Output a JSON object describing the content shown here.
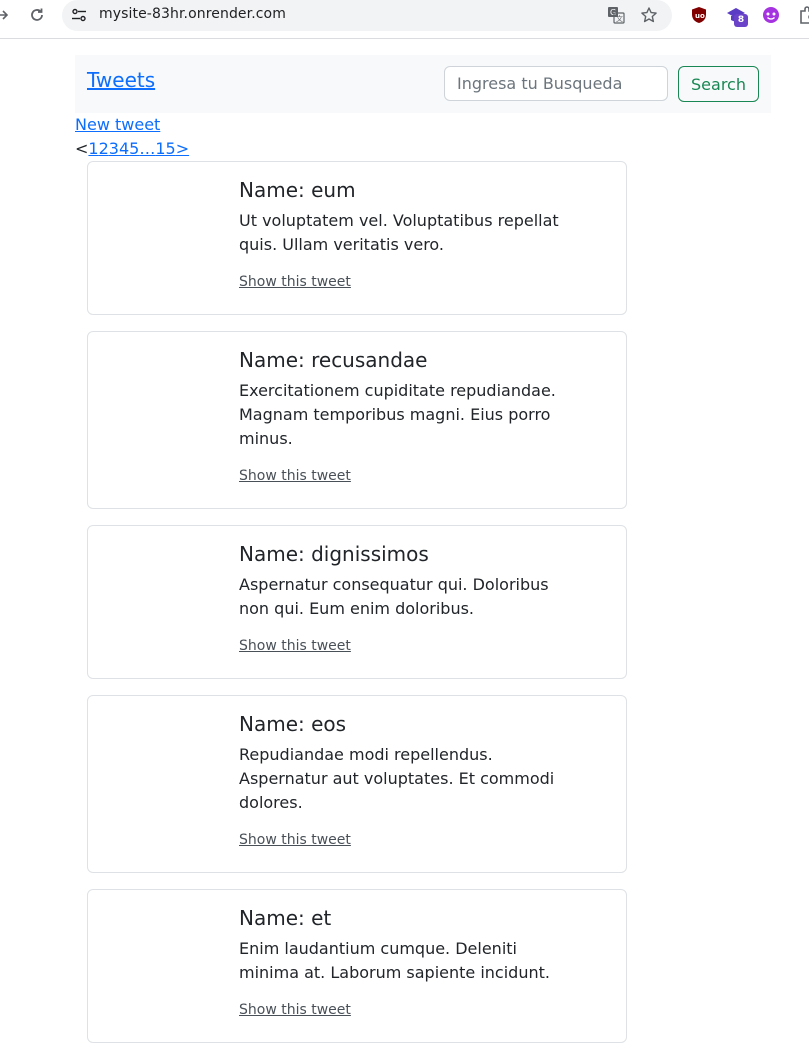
{
  "browser": {
    "url": "mysite-83hr.onrender.com",
    "extension_badge": "8"
  },
  "navbar": {
    "brand": "Tweets",
    "search_placeholder": "Ingresa tu Busqueda",
    "search_button": "Search"
  },
  "links": {
    "new_tweet": "New tweet"
  },
  "pagination": {
    "prev": "<",
    "pages": [
      "1",
      "2",
      "3",
      "4",
      "5"
    ],
    "ellipsis": "…",
    "last": "15",
    "next": ">"
  },
  "tweets": [
    {
      "title": "Name: eum",
      "text": "Ut voluptatem vel. Voluptatibus repellat quis. Ullam veritatis vero.",
      "link": "Show this tweet"
    },
    {
      "title": "Name: recusandae",
      "text": "Exercitationem cupiditate repudiandae. Magnam temporibus magni. Eius porro minus.",
      "link": "Show this tweet"
    },
    {
      "title": "Name: dignissimos",
      "text": "Aspernatur consequatur qui. Doloribus non qui. Eum enim doloribus.",
      "link": "Show this tweet"
    },
    {
      "title": "Name: eos",
      "text": "Repudiandae modi repellendus. Aspernatur aut voluptates. Et commodi dolores.",
      "link": "Show this tweet"
    },
    {
      "title": "Name: et",
      "text": "Enim laudantium cumque. Deleniti minima at. Laborum sapiente incidunt.",
      "link": "Show this tweet"
    }
  ],
  "colors": {
    "link": "#0d6efd",
    "success": "#198754",
    "navbar_bg": "#f8f9fa",
    "card_border": "#dee2e6"
  }
}
